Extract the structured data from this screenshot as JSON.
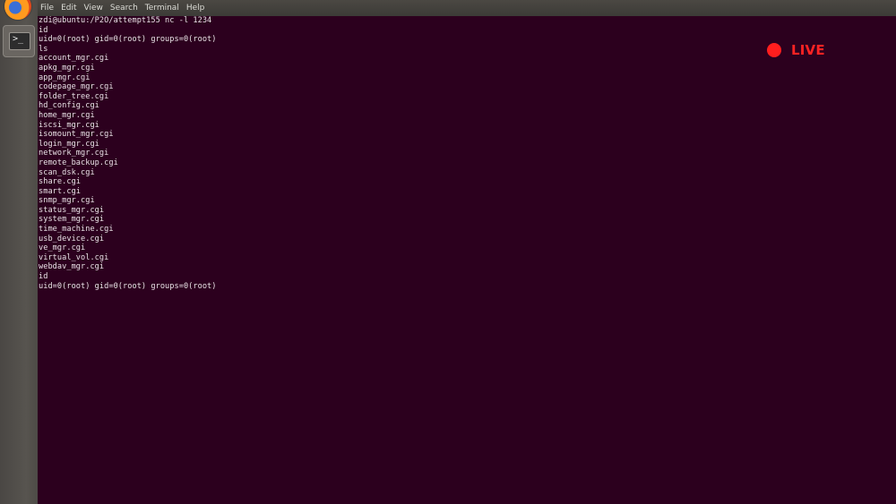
{
  "menubar": {
    "items": [
      {
        "label": "File"
      },
      {
        "label": "Edit"
      },
      {
        "label": "View"
      },
      {
        "label": "Search"
      },
      {
        "label": "Terminal"
      },
      {
        "label": "Help"
      }
    ]
  },
  "launcher": {
    "items": [
      {
        "icon": "firefox-icon"
      },
      {
        "icon": "terminal-icon",
        "glyph": ">_"
      }
    ]
  },
  "terminal": {
    "lines": [
      "zdi@ubuntu:/P2O/attempt155 nc -l 1234",
      "id",
      "uid=0(root) gid=0(root) groups=0(root)",
      "ls",
      "account_mgr.cgi",
      "apkg_mgr.cgi",
      "app_mgr.cgi",
      "codepage_mgr.cgi",
      "folder_tree.cgi",
      "hd_config.cgi",
      "home_mgr.cgi",
      "iscsi_mgr.cgi",
      "isomount_mgr.cgi",
      "login_mgr.cgi",
      "network_mgr.cgi",
      "remote_backup.cgi",
      "scan_dsk.cgi",
      "share.cgi",
      "smart.cgi",
      "snmp_mgr.cgi",
      "status_mgr.cgi",
      "system_mgr.cgi",
      "time_machine.cgi",
      "usb_device.cgi",
      "ve_mgr.cgi",
      "virtual_vol.cgi",
      "webdav_mgr.cgi",
      "id",
      "uid=0(root) gid=0(root) groups=0(root)"
    ]
  },
  "live_badge": {
    "label": "LIVE",
    "color": "#ff1e1e"
  },
  "colors": {
    "terminal_bg": "#2c001e",
    "terminal_fg": "#e9e3e6",
    "menubar_bg": "#3c3b37",
    "launcher_bg": "#57544f"
  }
}
